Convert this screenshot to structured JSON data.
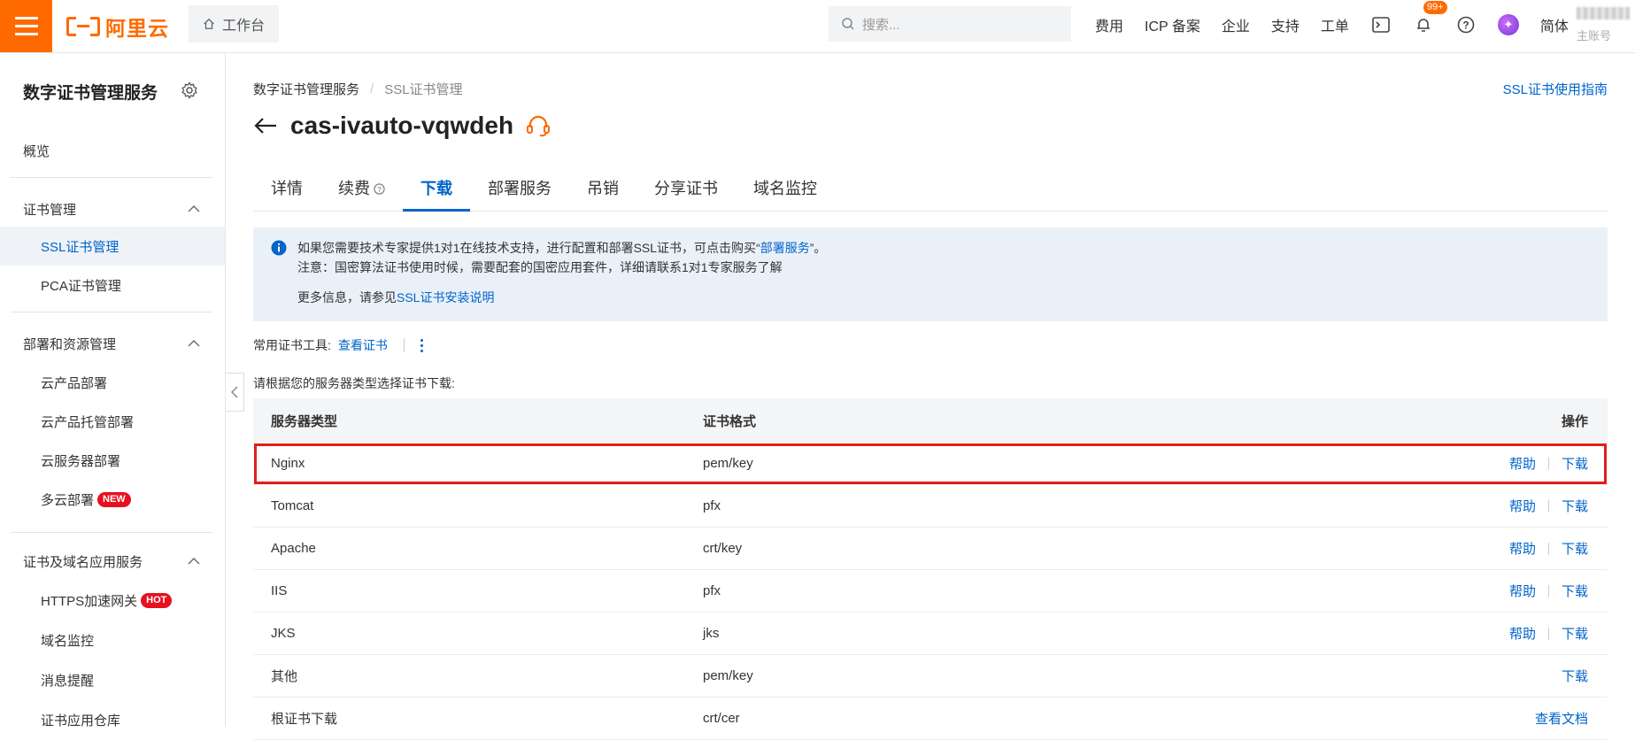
{
  "topbar": {
    "logo_text": "阿里云",
    "workbench": "工作台",
    "search_placeholder": "搜索...",
    "nav": [
      "费用",
      "ICP 备案",
      "企业",
      "支持",
      "工单"
    ],
    "notification_count": "99+",
    "language": "简体",
    "account_sub": "主账号"
  },
  "sidebar": {
    "title": "数字证书管理服务",
    "overview": "概览",
    "groups": [
      {
        "label": "证书管理",
        "items": [
          "SSL证书管理",
          "PCA证书管理"
        ]
      },
      {
        "label": "部署和资源管理",
        "items": [
          "云产品部署",
          "云产品托管部署",
          "云服务器部署",
          "多云部署"
        ]
      },
      {
        "label": "证书及域名应用服务",
        "items": [
          "HTTPS加速网关",
          "域名监控",
          "消息提醒",
          "证书应用仓库"
        ]
      }
    ],
    "tag_new": "NEW",
    "tag_hot": "HOT"
  },
  "main": {
    "breadcrumb": [
      "数字证书管理服务",
      "SSL证书管理"
    ],
    "guide_link": "SSL证书使用指南",
    "title": "cas-ivauto-vqwdeh",
    "tabs": [
      "详情",
      "续费",
      "下载",
      "部署服务",
      "吊销",
      "分享证书",
      "域名监控"
    ],
    "active_tab": "下载",
    "notice": {
      "line1_prefix": "如果您需要技术专家提供1对1在线技术支持，进行配置和部署SSL证书，可点击购买“",
      "line1_link": "部署服务",
      "line1_suffix": "”。",
      "line2": "注意：国密算法证书使用时候，需要配套的国密应用套件，详细请联系1对1专家服务了解",
      "line3_prefix": "更多信息，请参见",
      "line3_link": "SSL证书安装说明"
    },
    "tools_label": "常用证书工具:",
    "tools_link": "查看证书",
    "hint": "请根据您的服务器类型选择证书下载:",
    "table": {
      "headers": [
        "服务器类型",
        "证书格式",
        "操作"
      ],
      "rows": [
        {
          "server": "Nginx",
          "format": "pem/key",
          "help": "帮助",
          "action": "下载"
        },
        {
          "server": "Tomcat",
          "format": "pfx",
          "help": "帮助",
          "action": "下载"
        },
        {
          "server": "Apache",
          "format": "crt/key",
          "help": "帮助",
          "action": "下载"
        },
        {
          "server": "IIS",
          "format": "pfx",
          "help": "帮助",
          "action": "下载"
        },
        {
          "server": "JKS",
          "format": "jks",
          "help": "帮助",
          "action": "下载"
        },
        {
          "server": "其他",
          "format": "pem/key",
          "help": "",
          "action": "下载"
        },
        {
          "server": "根证书下载",
          "format": "crt/cer",
          "help": "",
          "action": "查看文档"
        }
      ]
    }
  },
  "colors": {
    "brand": "#ff6a00",
    "link": "#0064c8",
    "highlight": "#e01e1e",
    "tag": "#e6111f"
  }
}
